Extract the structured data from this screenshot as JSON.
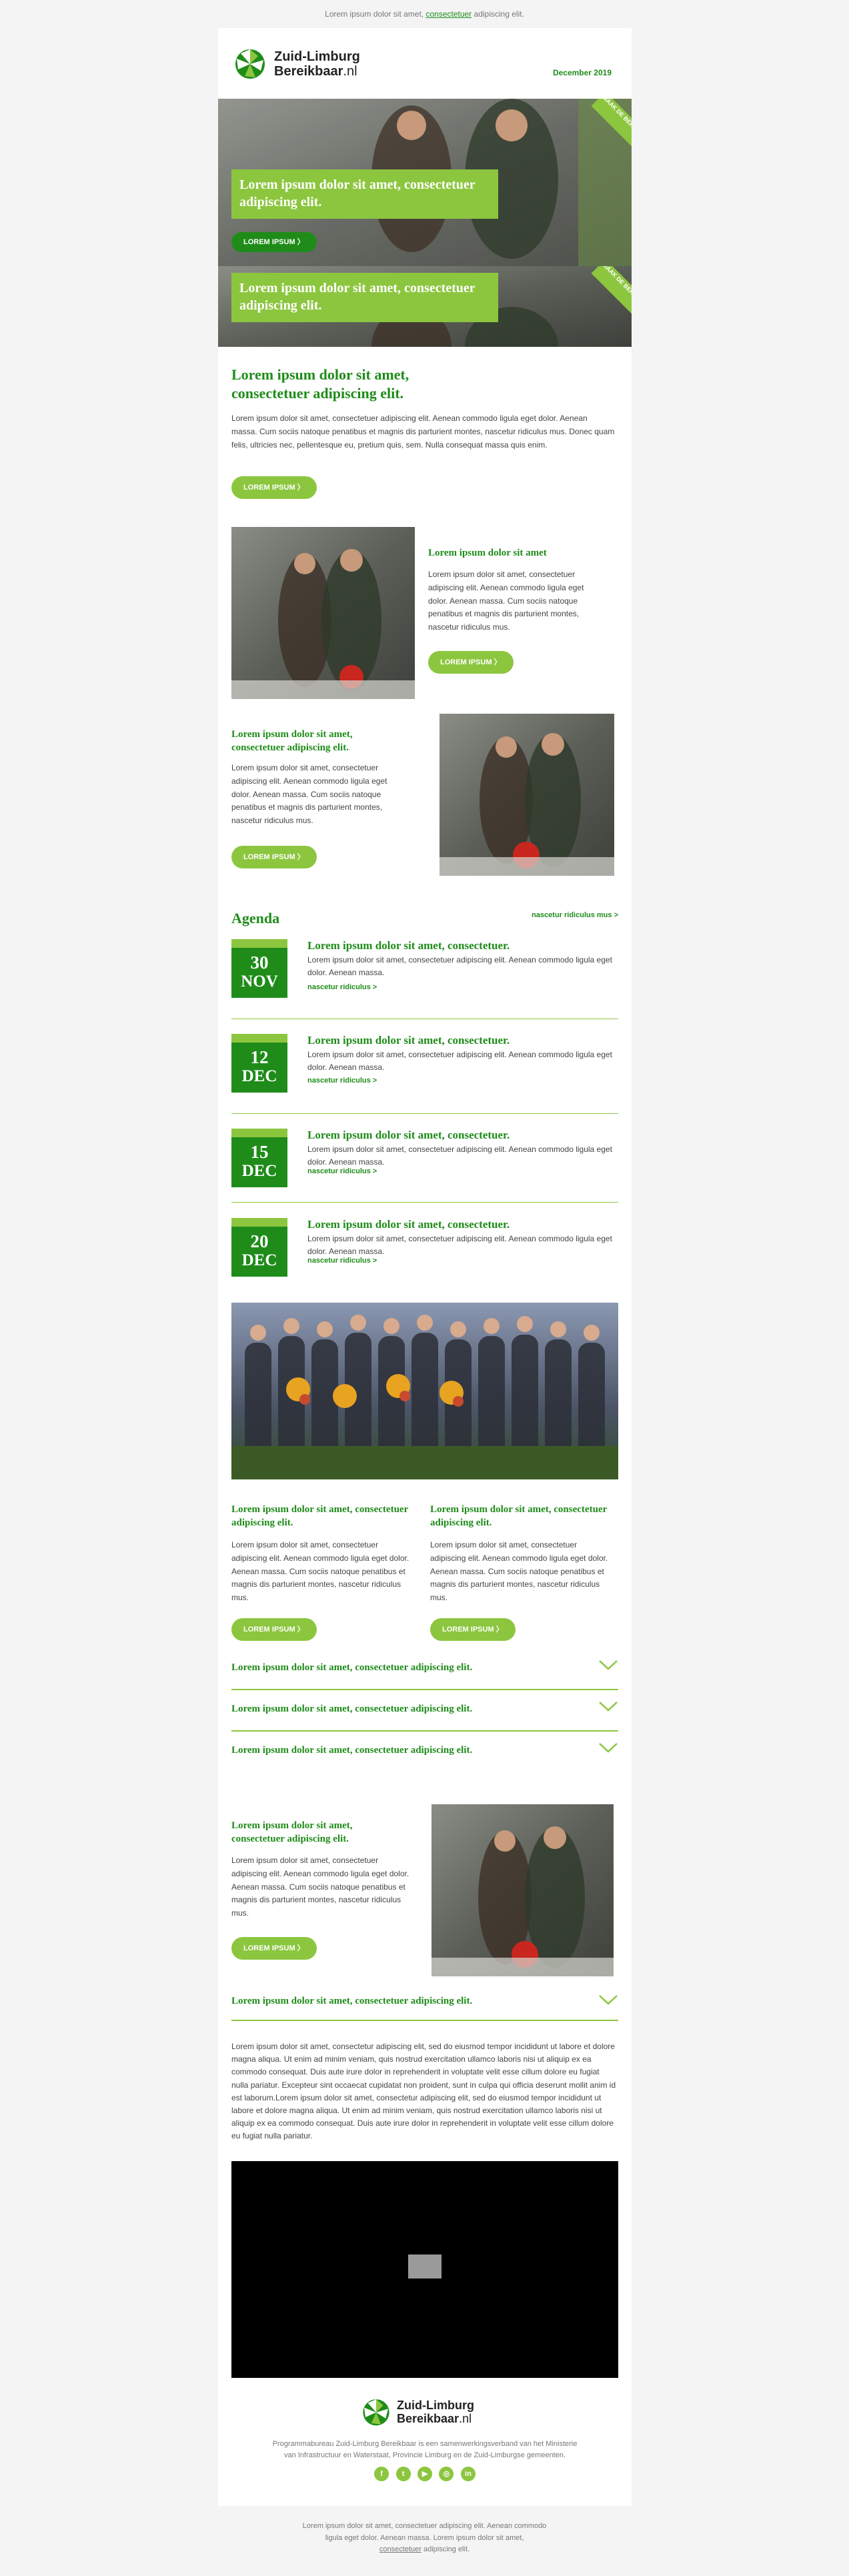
{
  "preheader": {
    "before": "Lorem ipsum dolor sit amet, ",
    "link": "consectetuer",
    "after": " adipiscing elit."
  },
  "header": {
    "brand_line1": "Zuid-Limburg",
    "brand_line2": "Bereikbaar",
    "brand_tld": ".nl",
    "date": "December 2019"
  },
  "hero": {
    "slide1_title": "Lorem ipsum dolor sit amet, consectetuer adipiscing elit.",
    "slide1_button": "LOREM IPSUM 〉",
    "slide2_title": "Lorem ipsum dolor sit amet, consectetuer adipiscing elit.",
    "corner_badge": "MAAK DE BEREIKBAAR",
    "corner_badge2": "MAAK DE BEREIKBAAR"
  },
  "intro": {
    "title": "Lorem ipsum dolor sit amet, consectetuer adipiscing elit.",
    "text": "Lorem ipsum dolor sit amet, consectetuer adipiscing elit. Aenean commodo ligula eget dolor. Aenean massa. Cum sociis natoque penatibus et magnis dis parturient montes, nascetur ridiculus mus. Donec quam felis, ultricies nec, pellentesque eu, pretium quis, sem. Nulla consequat massa quis enim.",
    "button": "LOREM IPSUM 〉"
  },
  "feature1": {
    "title": "Lorem ipsum dolor sit amet",
    "text": "Lorem ipsum dolor sit amet, consectetuer adipiscing elit. Aenean commodo ligula eget dolor. Aenean massa. Cum sociis natoque penatibus et magnis dis parturient montes, nascetur ridiculus mus.",
    "button": "LOREM IPSUM 〉"
  },
  "feature2": {
    "title": "Lorem ipsum dolor sit amet, consectetuer adipiscing elit.",
    "text": "Lorem ipsum dolor sit amet, consectetuer adipiscing elit. Aenean commodo ligula eget dolor. Aenean massa. Cum sociis natoque penatibus et magnis dis parturient montes, nascetur ridiculus mus.",
    "button": "LOREM IPSUM 〉"
  },
  "agenda": {
    "title": "Agenda",
    "more_link": "nascetur ridiculus mus >",
    "items": [
      {
        "day": "30",
        "month": "NOV",
        "title": "Lorem ipsum dolor sit amet, consectetuer.",
        "text": "Lorem ipsum dolor sit amet, consectetuer adipiscing elit. Aenean commodo ligula eget dolor. Aenean massa.",
        "link": "nascetur ridiculus >"
      },
      {
        "day": "12",
        "month": "DEC",
        "title": "Lorem ipsum dolor sit amet, consectetuer.",
        "text": "Lorem ipsum dolor sit amet, consectetuer adipiscing elit. Aenean commodo ligula eget dolor. Aenean massa.",
        "link": "nascetur ridiculus >"
      },
      {
        "day": "15",
        "month": "DEC",
        "title": "Lorem ipsum dolor sit amet, consectetuer.",
        "text": "Lorem ipsum dolor sit amet, consectetuer adipiscing elit. Aenean commodo ligula eget dolor. Aenean massa.",
        "link": "nascetur ridiculus >"
      },
      {
        "day": "20",
        "month": "DEC",
        "title": "Lorem ipsum dolor sit amet, consectetuer.",
        "text": "Lorem ipsum dolor sit amet, consectetuer adipiscing elit. Aenean commodo ligula eget dolor. Aenean massa.",
        "link": "nascetur ridiculus >"
      }
    ]
  },
  "two_col": {
    "left_title": "Lorem ipsum dolor sit amet, consectetuer adipiscing elit.",
    "left_text": "Lorem ipsum dolor sit amet, consectetuer adipiscing elit. Aenean commodo ligula eget dolor. Aenean massa. Cum sociis natoque penatibus et magnis dis parturient montes, nascetur ridiculus mus.",
    "left_button": "LOREM IPSUM 〉",
    "right_title": "Lorem ipsum dolor sit amet, consectetuer adipiscing elit.",
    "right_text": "Lorem ipsum dolor sit amet, consectetuer adipiscing elit. Aenean commodo ligula eget dolor. Aenean massa. Cum sociis natoque penatibus et magnis dis parturient montes, nascetur ridiculus mus.",
    "right_button": "LOREM IPSUM 〉"
  },
  "accordion": [
    "Lorem ipsum dolor sit amet, consectetuer adipiscing elit.",
    "Lorem ipsum dolor sit amet, consectetuer adipiscing elit.",
    "Lorem ipsum dolor sit amet, consectetuer adipiscing elit."
  ],
  "feature3": {
    "title": "Lorem ipsum dolor sit amet, consectetuer adipiscing elit.",
    "text": "Lorem ipsum dolor sit amet, consectetuer adipiscing elit. Aenean commodo ligula eget dolor. Aenean massa. Cum sociis natoque penatibus et magnis dis parturient montes, nascetur ridiculus mus.",
    "button": "LOREM IPSUM 〉"
  },
  "accordion_open": {
    "title": "Lorem ipsum dolor sit amet, consectetuer adipiscing elit.",
    "text": "Lorem ipsum dolor sit amet, consectetur adipiscing elit, sed do eiusmod tempor incididunt ut labore et dolore magna aliqua. Ut enim ad minim veniam, quis nostrud exercitation ullamco laboris nisi ut aliquip ex ea commodo consequat. Duis aute irure dolor in reprehenderit in voluptate velit esse cillum dolore eu fugiat nulla pariatur. Excepteur sint occaecat cupidatat non proident, sunt in culpa qui officia deserunt mollit anim id est laborum.Lorem ipsum dolor sit amet, consectetur adipiscing elit, sed do eiusmod tempor incididunt ut labore et dolore magna aliqua. Ut enim ad minim veniam, quis nostrud exercitation ullamco laboris nisi ut aliquip ex ea commodo consequat. Duis aute irure dolor in reprehenderit in voluptate velit esse cillum dolore eu fugiat nulla pariatur."
  },
  "bottom": {
    "brand_line1": "Zuid-Limburg",
    "brand_line2": "Bereikbaar",
    "brand_tld": ".nl",
    "disclaimer": "Programmabureau Zuid-Limburg Bereikbaar is een samenwerkingsverband van het Ministerie van Infrastructuur en Waterstaat, Provincie Limburg en de Zuid-Limburgse gemeenten.",
    "social": [
      "f",
      "t",
      "▶",
      "◎",
      "in"
    ]
  },
  "footer": {
    "line1": "Lorem ipsum dolor sit amet, consectetuer adipiscing elit. Aenean commodo",
    "line2": "ligula eget dolor. Aenean massa. Lorem ipsum dolor sit amet,",
    "link": "consectetuer",
    "after": " adipiscing elit."
  },
  "colors": {
    "brand_green": "#1f8c1a",
    "light_green": "#8cc63f",
    "background": "#f4f4f4"
  },
  "icons": [
    "leaf-logo-icon",
    "chevron-down-icon",
    "video-play-icon",
    "facebook-icon",
    "twitter-icon",
    "youtube-icon",
    "instagram-icon",
    "linkedin-icon"
  ]
}
